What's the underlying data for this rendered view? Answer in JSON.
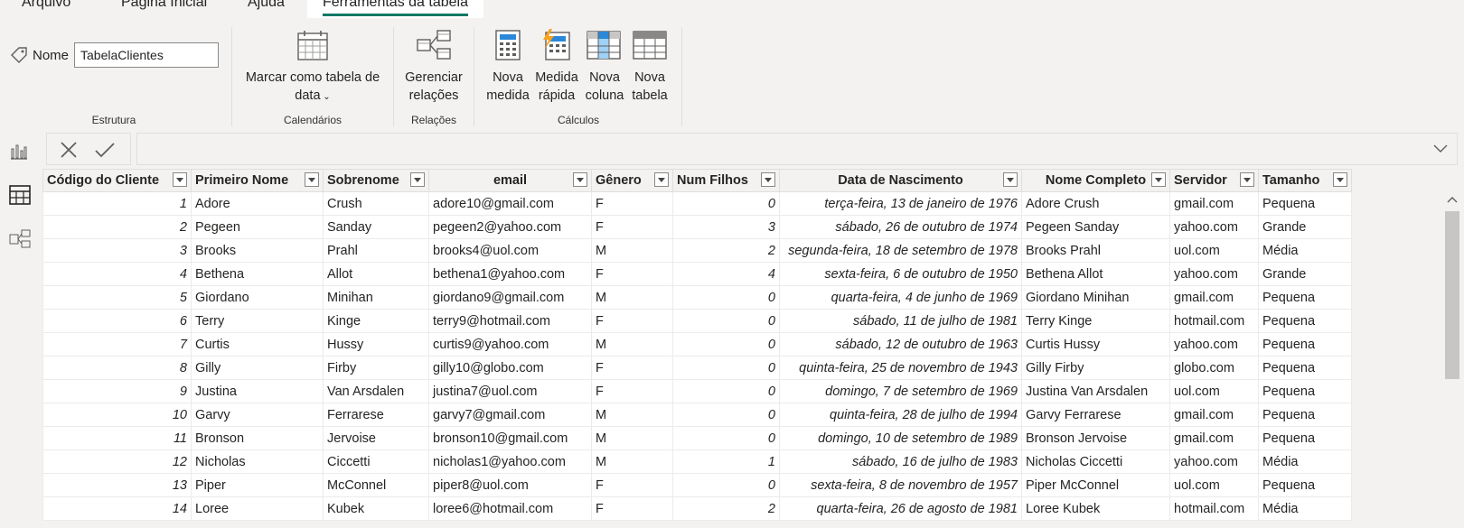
{
  "menu": {
    "tabs": [
      {
        "label": "Arquivo"
      },
      {
        "label": "Página Inicial"
      },
      {
        "label": "Ajuda"
      },
      {
        "label": "Ferramentas da tabela"
      }
    ]
  },
  "ribbon": {
    "name_label": "Nome",
    "name_value": "TabelaClientes",
    "groups": {
      "estrutura": "Estrutura",
      "calendarios": "Calendários",
      "relacoes": "Relações",
      "calculos": "Cálculos"
    },
    "buttons": {
      "mark_date_line1": "Marcar como tabela de",
      "mark_date_line2": "data",
      "manage_rel_line1": "Gerenciar",
      "manage_rel_line2": "relações",
      "new_measure_line1": "Nova",
      "new_measure_line2": "medida",
      "quick_measure_line1": "Medida",
      "quick_measure_line2": "rápida",
      "new_column_line1": "Nova",
      "new_column_line2": "coluna",
      "new_table_line1": "Nova",
      "new_table_line2": "tabela"
    }
  },
  "table": {
    "headers": [
      "Código do Cliente",
      "Primeiro Nome",
      "Sobrenome",
      "email",
      "Gênero",
      "Num Filhos",
      "Data de Nascimento",
      "Nome Completo",
      "Servidor",
      "Tamanho"
    ],
    "rows": [
      [
        "1",
        "Adore",
        "Crush",
        "adore10@gmail.com",
        "F",
        "0",
        "terça-feira, 13 de janeiro de 1976",
        "Adore Crush",
        "gmail.com",
        "Pequena"
      ],
      [
        "2",
        "Pegeen",
        "Sanday",
        "pegeen2@yahoo.com",
        "F",
        "3",
        "sábado, 26 de outubro de 1974",
        "Pegeen Sanday",
        "yahoo.com",
        "Grande"
      ],
      [
        "3",
        "Brooks",
        "Prahl",
        "brooks4@uol.com",
        "M",
        "2",
        "segunda-feira, 18 de setembro de 1978",
        "Brooks Prahl",
        "uol.com",
        "Média"
      ],
      [
        "4",
        "Bethena",
        "Allot",
        "bethena1@yahoo.com",
        "F",
        "4",
        "sexta-feira, 6 de outubro de 1950",
        "Bethena Allot",
        "yahoo.com",
        "Grande"
      ],
      [
        "5",
        "Giordano",
        "Minihan",
        "giordano9@gmail.com",
        "M",
        "0",
        "quarta-feira, 4 de junho de 1969",
        "Giordano Minihan",
        "gmail.com",
        "Pequena"
      ],
      [
        "6",
        "Terry",
        "Kinge",
        "terry9@hotmail.com",
        "F",
        "0",
        "sábado, 11 de julho de 1981",
        "Terry Kinge",
        "hotmail.com",
        "Pequena"
      ],
      [
        "7",
        "Curtis",
        "Hussy",
        "curtis9@yahoo.com",
        "M",
        "0",
        "sábado, 12 de outubro de 1963",
        "Curtis Hussy",
        "yahoo.com",
        "Pequena"
      ],
      [
        "8",
        "Gilly",
        "Firby",
        "gilly10@globo.com",
        "F",
        "0",
        "quinta-feira, 25 de novembro de 1943",
        "Gilly Firby",
        "globo.com",
        "Pequena"
      ],
      [
        "9",
        "Justina",
        "Van Arsdalen",
        "justina7@uol.com",
        "F",
        "0",
        "domingo, 7 de setembro de 1969",
        "Justina Van Arsdalen",
        "uol.com",
        "Pequena"
      ],
      [
        "10",
        "Garvy",
        "Ferrarese",
        "garvy7@gmail.com",
        "M",
        "0",
        "quinta-feira, 28 de julho de 1994",
        "Garvy Ferrarese",
        "gmail.com",
        "Pequena"
      ],
      [
        "11",
        "Bronson",
        "Jervoise",
        "bronson10@gmail.com",
        "M",
        "0",
        "domingo, 10 de setembro de 1989",
        "Bronson Jervoise",
        "gmail.com",
        "Pequena"
      ],
      [
        "12",
        "Nicholas",
        "Ciccetti",
        "nicholas1@yahoo.com",
        "M",
        "1",
        "sábado, 16 de julho de 1983",
        "Nicholas Ciccetti",
        "yahoo.com",
        "Média"
      ],
      [
        "13",
        "Piper",
        "McConnel",
        "piper8@uol.com",
        "F",
        "0",
        "sexta-feira, 8 de novembro de 1957",
        "Piper McConnel",
        "uol.com",
        "Pequena"
      ],
      [
        "14",
        "Loree",
        "Kubek",
        "loree6@hotmail.com",
        "F",
        "2",
        "quarta-feira, 26 de agosto de 1981",
        "Loree Kubek",
        "hotmail.com",
        "Média"
      ]
    ]
  },
  "icons": {
    "tag": "tag-icon",
    "report_view": "bar-chart-icon",
    "data_view": "table-grid-icon",
    "model_view": "model-icon",
    "cancel": "close-icon",
    "commit": "check-icon",
    "expand": "chevron-down-icon"
  },
  "colors": {
    "accent": "#117865",
    "header_bg": "#f3f2f1",
    "grid_line": "#edebe9"
  }
}
